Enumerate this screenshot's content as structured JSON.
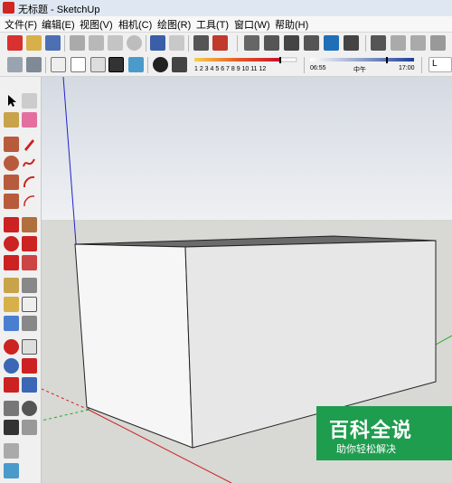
{
  "window": {
    "title": "无标题 - SketchUp"
  },
  "menu": [
    "文件(F)",
    "编辑(E)",
    "视图(V)",
    "相机(C)",
    "绘图(R)",
    "工具(T)",
    "窗口(W)",
    "帮助(H)"
  ],
  "shadow_settings": {
    "month_scale": "1 2 3 4 5 6 7 8 9 10 11 12",
    "time_start": "06:55",
    "time_mid": "中午",
    "time_end": "17:00"
  },
  "toolbar_right_label": "L",
  "watermark": {
    "title": "百科全说",
    "subtitle": "助你轻松解决"
  },
  "colors": {
    "sky": "#e4e7ec",
    "ground": "#d9d9d5",
    "box_top": "#6e6e6e",
    "box_front": "#f4f4f4",
    "box_side": "#e6e6e6",
    "axis_blue": "#2222cc",
    "axis_red": "#cc2222",
    "axis_green": "#22aa22",
    "watermark_bg": "#1f9d4f"
  }
}
